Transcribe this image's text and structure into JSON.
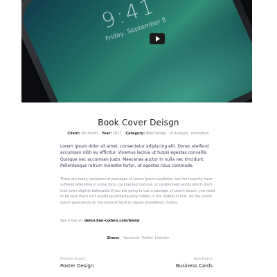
{
  "hero": {
    "phone_time": "9:41",
    "phone_date": "Friday, September 8",
    "play_label": "Play video"
  },
  "project": {
    "title": "Book Cover Deisgn",
    "client_label": "Client:",
    "client_value": "Wil Smith",
    "year_label": "Year:",
    "year_value": "2017",
    "category_label": "Category:",
    "categories": [
      "Web Design",
      "UI Analysis",
      "Promotion"
    ]
  },
  "content": {
    "lead": "Lorem ipsum dolor sit amet, consectetur adipiscing elit. Donec eleifend accumsan nibh eu efficitur. Vivamus lacinia ut turpis egestas convallis. Quisque nec accumsan justo. Maecenas auctor in nulla nec tincidunt. Pellentesque rutrum molestie tortor, ut egestas risus commodo.",
    "body": "There are many variations of passages of Lorem Ipsum available, but the majority have suffered alteration in some form, by injected humour, or randomised words which don't look even slightly believable.If you are going to use a passage of Lorem Ipsum, you need to be sure there isn't anything embarrassing hidden in the middle of text. All the Lorem Ipsum generators on the Internet tend to repeat predefined chunks.",
    "see_live_label": "See it live at:",
    "see_live_link": "demo.lian-coders.com/blend"
  },
  "share": {
    "label": "Share:",
    "links": [
      "Facebook",
      "Twitter",
      "Linkedin"
    ]
  },
  "pagination": {
    "prev_label": "Previous Project",
    "prev_name": "Poster Design",
    "next_label": "Next Project",
    "next_name": "Business Cards"
  }
}
